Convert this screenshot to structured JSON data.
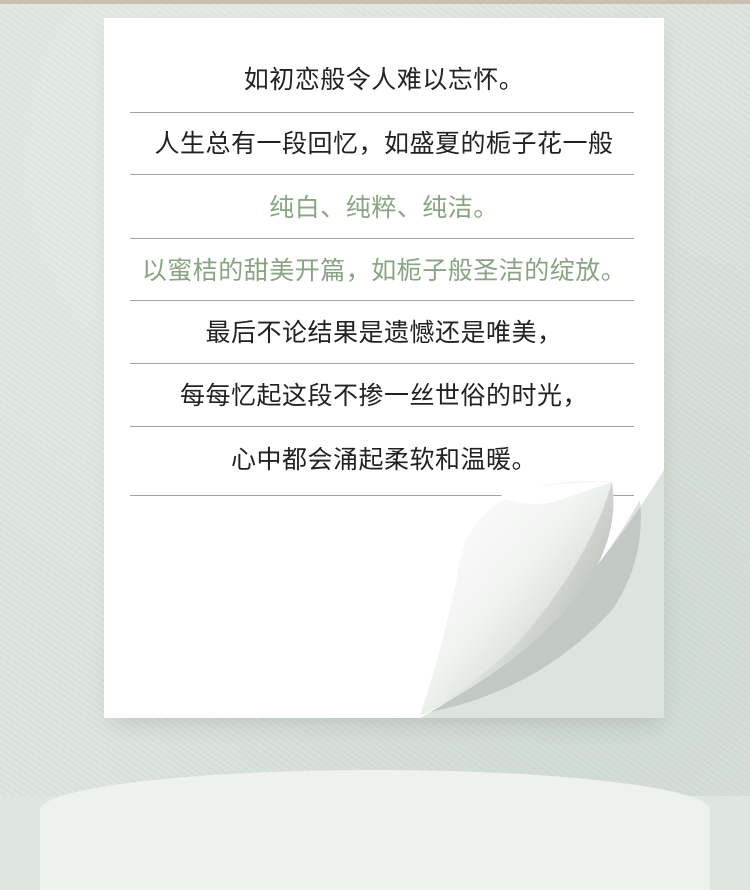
{
  "poem": {
    "lines": [
      {
        "text": "如初恋般令人难以忘怀。",
        "color": "#222222"
      },
      {
        "text": "人生总有一段回忆，如盛夏的栀子花一般",
        "color": "#222222"
      },
      {
        "text": "纯白、纯粹、纯洁。",
        "color": "#8aa384"
      },
      {
        "text": "以蜜桔的甜美开篇，如栀子般圣洁的绽放。",
        "color": "#8aa384"
      },
      {
        "text": "最后不论结果是遗憾还是唯美，",
        "color": "#222222"
      },
      {
        "text": "每每忆起这段不掺一丝世俗的时光，",
        "color": "#222222"
      },
      {
        "text": "心中都会涌起柔软和温暖。",
        "color": "#222222"
      }
    ]
  },
  "colors": {
    "background": "#dde4df",
    "paper": "#ffffff",
    "rule": "#9ea79a",
    "accent_green": "#8aa384"
  }
}
